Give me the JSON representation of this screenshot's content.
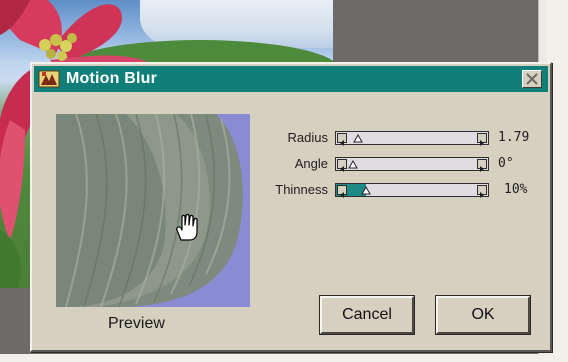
{
  "dialog": {
    "title": "Motion Blur",
    "close_icon": "close-icon",
    "app_icon": "filter-app-icon"
  },
  "preview": {
    "label": "Preview",
    "cursor_icon": "hand-cursor-icon"
  },
  "params": {
    "radius": {
      "label": "Radius",
      "value": "1.79",
      "level": 0.04
    },
    "angle": {
      "label": "Angle",
      "value": "0°",
      "level": 0.0
    },
    "thinness": {
      "label": "Thinness",
      "value": "10%",
      "level": 0.1
    }
  },
  "buttons": {
    "cancel": "Cancel",
    "ok": "OK"
  },
  "colors": {
    "titlebar": "#107e79",
    "dialog_face": "#d5d0c0",
    "slider_fill": "#1d8a86"
  }
}
